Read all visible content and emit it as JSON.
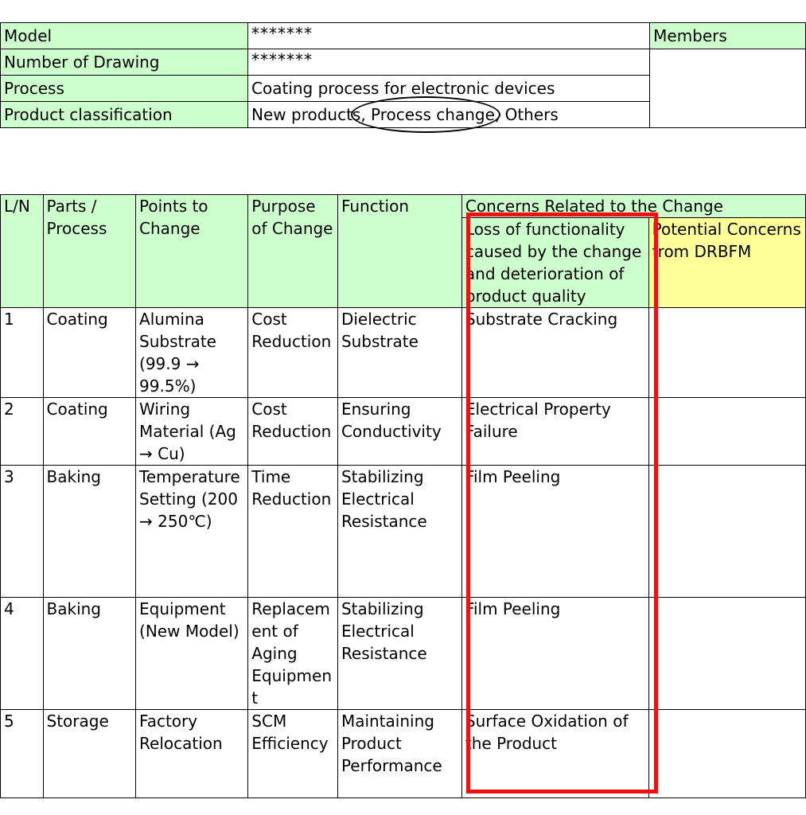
{
  "info": {
    "model_label": "Model",
    "model_value": "*******",
    "members_label": "Members",
    "drawing_label": "Number of Drawing",
    "drawing_value": "*******",
    "process_label": "Process",
    "process_value": "Coating process for electronic devices",
    "classification_label": "Product classification",
    "classification_value": "New products, Process change, Others",
    "circled_option": "Process change"
  },
  "table": {
    "headers": {
      "ln": "L/N",
      "parts": "Parts / Process",
      "points": "Points to Change",
      "purpose": "Purpose of Change",
      "function": "Function",
      "concerns": "Concerns Related to the Change",
      "loss": "Loss of functionality caused by the change and deterioration of product quality",
      "potential": "Potential Concerns from DRBFM"
    },
    "rows": [
      {
        "ln": "1",
        "parts": "Coating",
        "points": "Alumina Substrate (99.9 → 99.5%)",
        "purpose": "Cost Reduction",
        "function": "Dielectric Substrate",
        "loss": "Substrate Cracking",
        "potential": ""
      },
      {
        "ln": "2",
        "parts": "Coating",
        "points": "Wiring Material (Ag → Cu)",
        "purpose": "Cost Reduction",
        "function": "Ensuring Conductivity",
        "loss": "Electrical Property Failure",
        "potential": ""
      },
      {
        "ln": "3",
        "parts": "Baking",
        "points": "Temperature Setting (200 → 250℃)",
        "purpose": "Time Reduction",
        "function": "Stabilizing Electrical Resistance",
        "loss": "Film Peeling",
        "potential": ""
      },
      {
        "ln": "4",
        "parts": "Baking",
        "points": "Equipment (New Model)",
        "purpose": "Replacement of Aging Equipment",
        "function": "Stabilizing Electrical Resistance",
        "loss": "Film Peeling",
        "potential": ""
      },
      {
        "ln": "5",
        "parts": "Storage",
        "points": "Factory Relocation",
        "purpose": "SCM Efficiency",
        "function": "Maintaining Product Performance",
        "loss": "Surface Oxidation of the Product",
        "potential": ""
      }
    ]
  },
  "colors": {
    "header_green": "#ccffcc",
    "header_yellow": "#ffff99",
    "highlight_red": "#ee1111"
  }
}
